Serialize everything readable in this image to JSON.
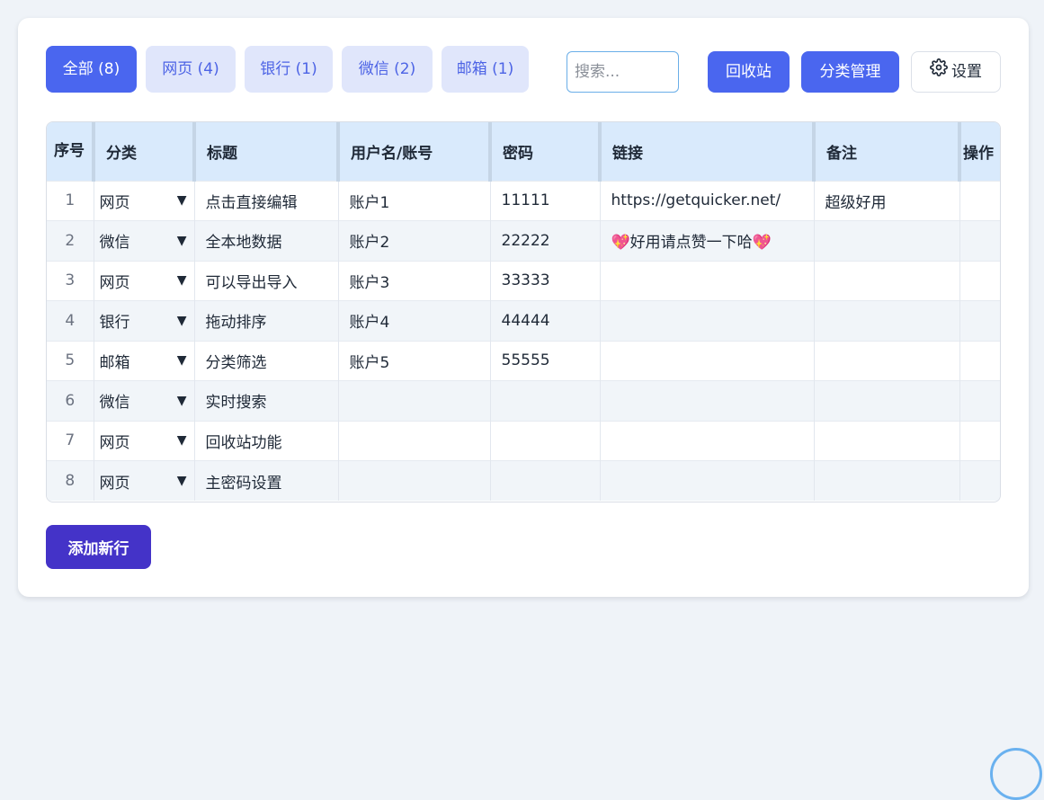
{
  "filters": [
    {
      "label": "全部 (8)",
      "active": true
    },
    {
      "label": "网页 (4)",
      "active": false
    },
    {
      "label": "银行 (1)",
      "active": false
    },
    {
      "label": "微信 (2)",
      "active": false
    },
    {
      "label": "邮箱 (1)",
      "active": false
    }
  ],
  "search": {
    "placeholder": "搜索..."
  },
  "actions": {
    "recycle": "回收站",
    "category_manage": "分类管理",
    "settings": "设置"
  },
  "table": {
    "headers": [
      "序号",
      "分类",
      "标题",
      "用户名/账号",
      "密码",
      "链接",
      "备注",
      "操作"
    ],
    "rows": [
      {
        "index": "1",
        "category": "网页",
        "title": "点击直接编辑",
        "username": "账户1",
        "password": "11111",
        "link": "https://getquicker.net/",
        "note": "超级好用"
      },
      {
        "index": "2",
        "category": "微信",
        "title": "全本地数据",
        "username": "账户2",
        "password": "22222",
        "link": "💖好用请点赞一下哈💖",
        "note": ""
      },
      {
        "index": "3",
        "category": "网页",
        "title": "可以导出导入",
        "username": "账户3",
        "password": "33333",
        "link": "",
        "note": ""
      },
      {
        "index": "4",
        "category": "银行",
        "title": "拖动排序",
        "username": "账户4",
        "password": "44444",
        "link": "",
        "note": ""
      },
      {
        "index": "5",
        "category": "邮箱",
        "title": "分类筛选",
        "username": "账户5",
        "password": "55555",
        "link": "",
        "note": ""
      },
      {
        "index": "6",
        "category": "微信",
        "title": "实时搜索",
        "username": "",
        "password": "",
        "link": "",
        "note": ""
      },
      {
        "index": "7",
        "category": "网页",
        "title": "回收站功能",
        "username": "",
        "password": "",
        "link": "",
        "note": ""
      },
      {
        "index": "8",
        "category": "网页",
        "title": "主密码设置",
        "username": "",
        "password": "",
        "link": "",
        "note": ""
      }
    ]
  },
  "add_row": "添加新行",
  "icons": {
    "settings": "gear-icon",
    "dropdown": "caret-down-icon"
  },
  "colors": {
    "primary": "#4a66ef",
    "filter_inactive_bg": "#e0e6fb",
    "add_button": "#4433c8",
    "header_bg": "#d9eafc"
  }
}
